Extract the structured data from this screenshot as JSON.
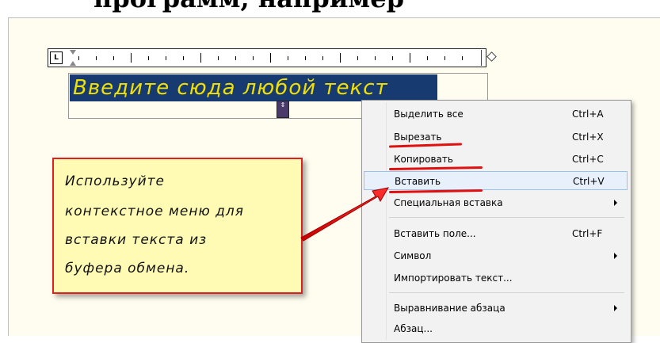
{
  "header": {
    "partial_title": "программ, например"
  },
  "editor": {
    "sample_text": "Введите сюда любой текст",
    "ruler_corner": "L",
    "handle_glyph": "⇕"
  },
  "callout": {
    "lines": [
      "Используйте",
      "контекстное меню для",
      "вставки текста из",
      "буфера обмена."
    ]
  },
  "context_menu": {
    "items": [
      {
        "label": "Выделить все",
        "shortcut": "Ctrl+A"
      },
      {
        "label": "Вырезать",
        "shortcut": "Ctrl+X"
      },
      {
        "label": "Копировать",
        "shortcut": "Ctrl+C"
      },
      {
        "label": "Вставить",
        "shortcut": "Ctrl+V"
      },
      {
        "label": "Специальная вставка",
        "shortcut": ""
      },
      {
        "label": "Вставить поле...",
        "shortcut": "Ctrl+F"
      },
      {
        "label": "Символ",
        "shortcut": ""
      },
      {
        "label": "Импортировать текст...",
        "shortcut": ""
      },
      {
        "label": "Выравнивание абзаца",
        "shortcut": ""
      },
      {
        "label": "Абзац...",
        "shortcut": ""
      }
    ],
    "highlighted_item": "Вставить"
  },
  "colors": {
    "editor_bg": "#173a70",
    "editor_text": "#f0e000",
    "callout_bg": "#fffbb5",
    "callout_border": "#e02020",
    "annotation_red": "#e01010"
  }
}
